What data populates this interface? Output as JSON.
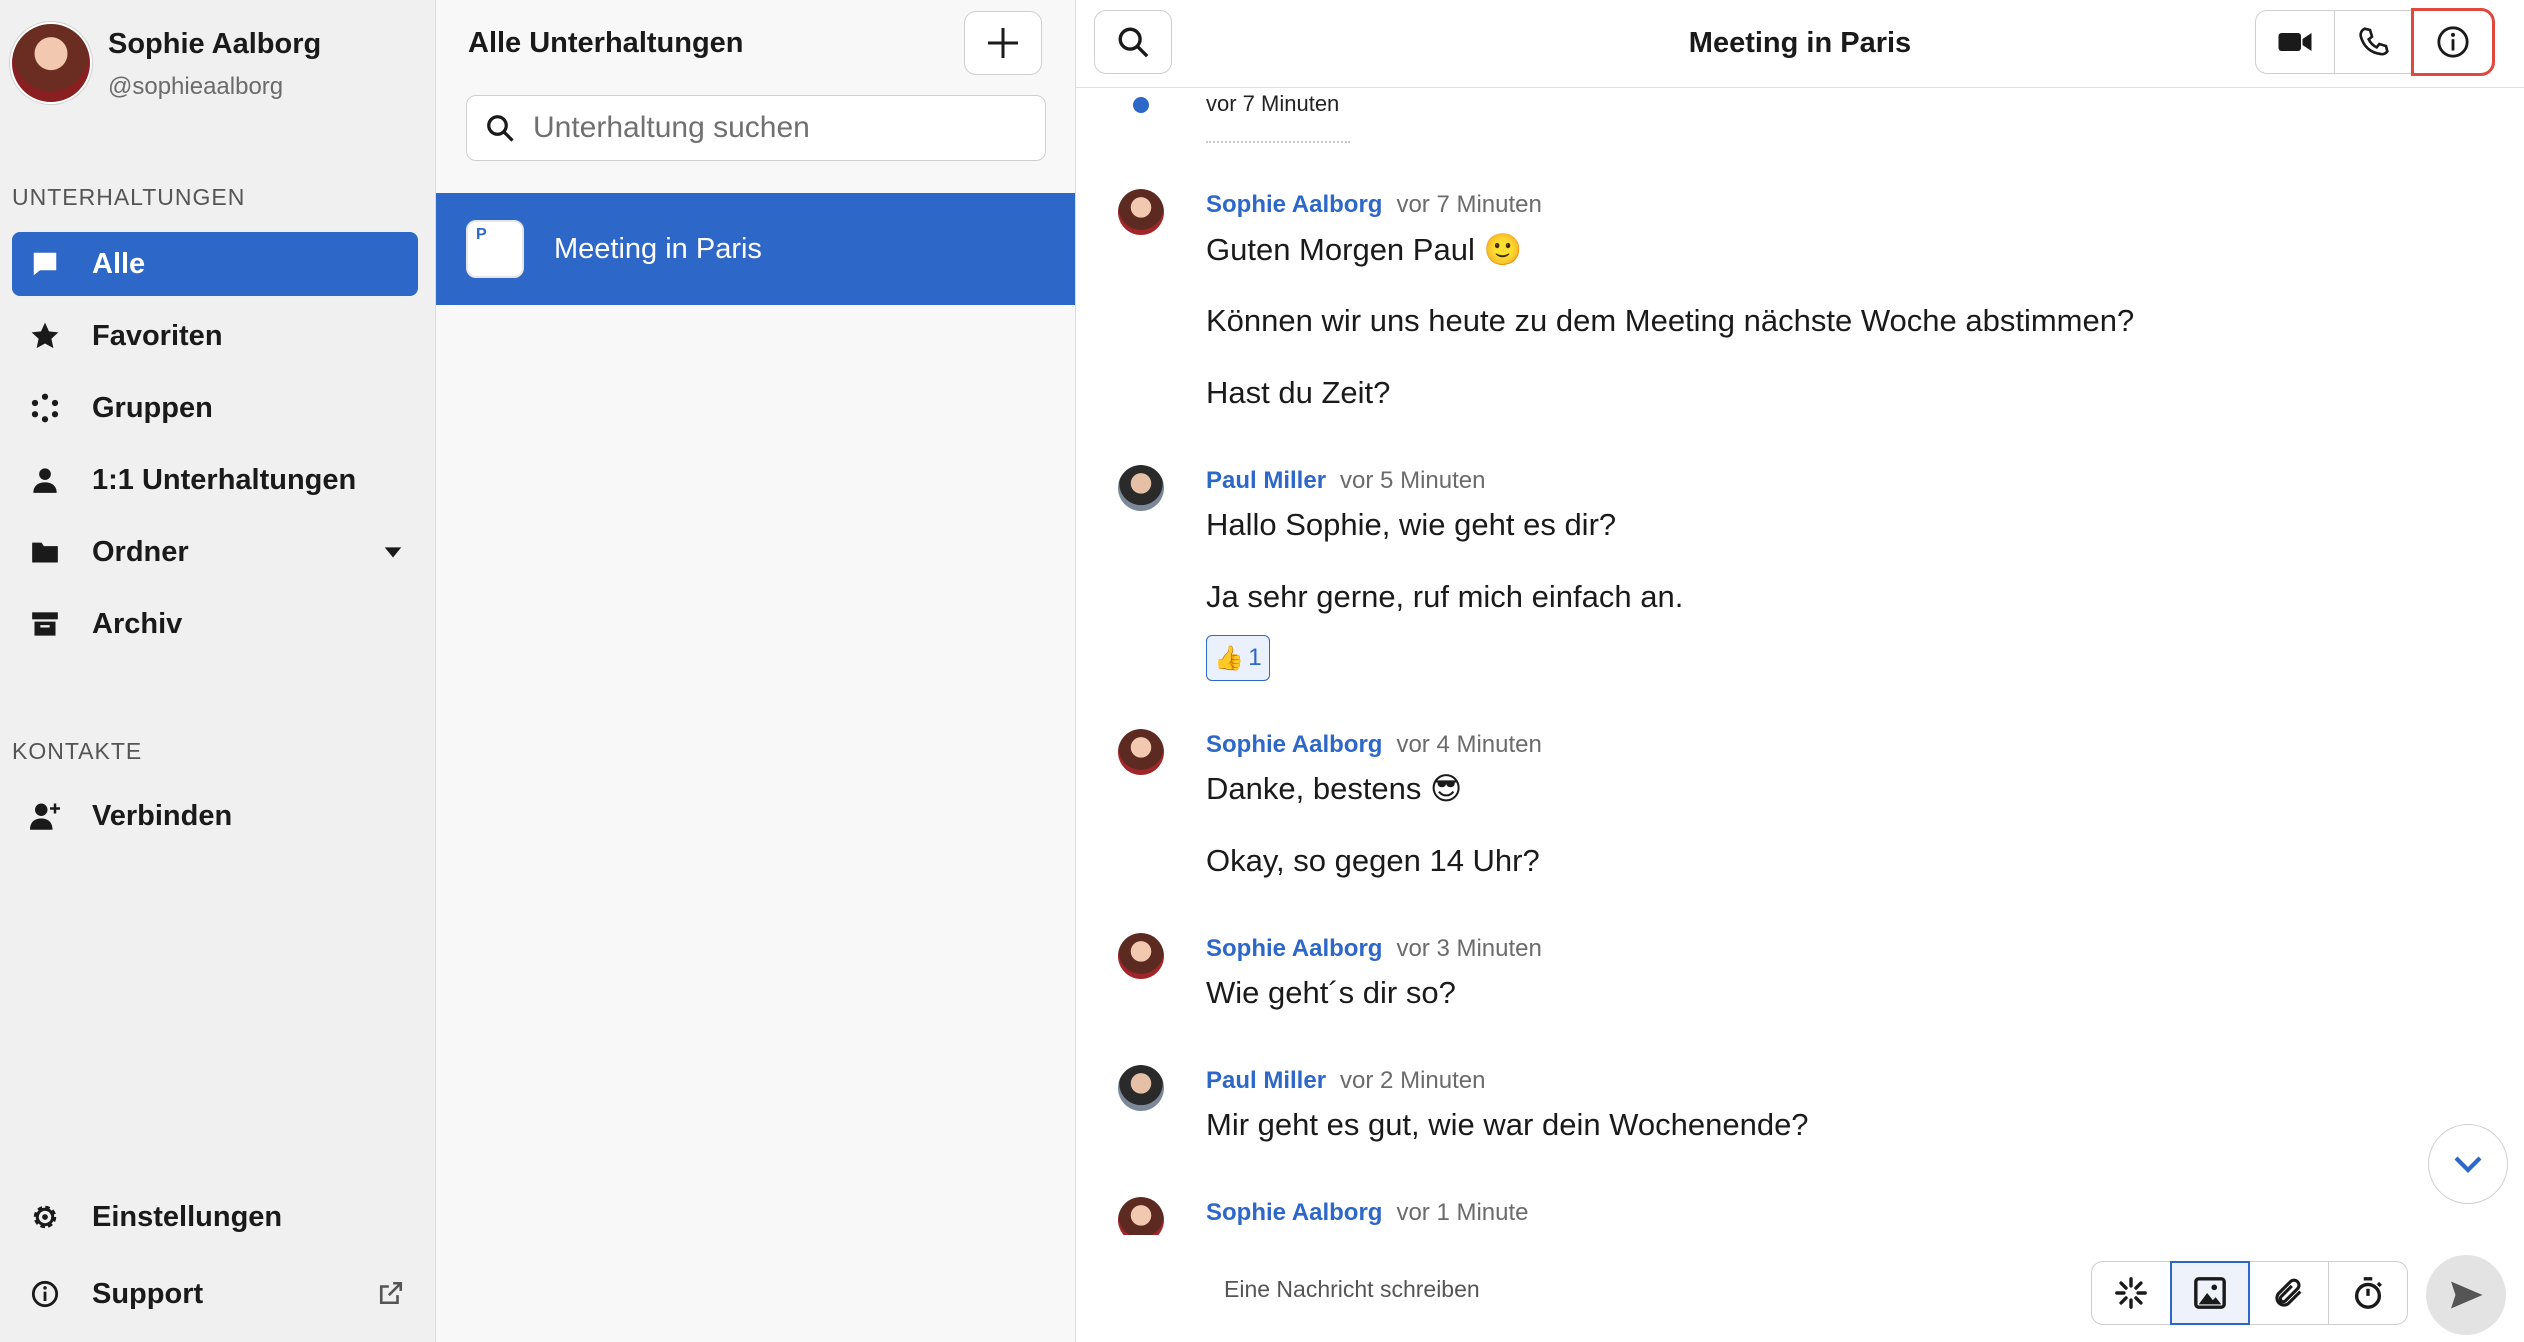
{
  "profile": {
    "name": "Sophie Aalborg",
    "handle": "@sophieaalborg"
  },
  "sidebar": {
    "section_conversations": "UNTERHALTUNGEN",
    "items": [
      {
        "label": "Alle",
        "icon": "chat-bubble-icon",
        "active": true
      },
      {
        "label": "Favoriten",
        "icon": "star-icon"
      },
      {
        "label": "Gruppen",
        "icon": "groups-icon"
      },
      {
        "label": "1:1 Unterhaltungen",
        "icon": "person-icon"
      },
      {
        "label": "Ordner",
        "icon": "folder-icon"
      },
      {
        "label": "Archiv",
        "icon": "archive-icon"
      }
    ],
    "section_contacts": "KONTAKTE",
    "connect_label": "Verbinden",
    "settings_label": "Einstellungen",
    "support_label": "Support"
  },
  "convlist": {
    "title": "Alle Unterhaltungen",
    "search_placeholder": "Unterhaltung suchen",
    "items": [
      {
        "name": "Meeting in Paris",
        "initial": "P",
        "selected": true
      }
    ]
  },
  "chat": {
    "title": "Meeting in Paris",
    "unread_marker_time": "vor 7 Minuten",
    "messages": [
      {
        "author": "Sophie Aalborg",
        "time": "vor 7 Minuten",
        "lines": [
          "Guten Morgen Paul 🙂",
          "Können wir uns heute zu dem Meeting nächste Woche abstimmen?",
          "Hast du Zeit?"
        ]
      },
      {
        "author": "Paul Miller",
        "time": "vor 5 Minuten",
        "lines": [
          "Hallo Sophie, wie geht es dir?",
          "Ja sehr gerne, ruf mich einfach an."
        ],
        "reaction": {
          "emoji": "👍",
          "count": "1"
        }
      },
      {
        "author": "Sophie Aalborg",
        "time": "vor 4 Minuten",
        "lines": [
          "Danke, bestens 😎",
          "Okay, so gegen 14 Uhr?"
        ]
      },
      {
        "author": "Sophie Aalborg",
        "time": "vor 3 Minuten",
        "lines": [
          "Wie geht´s dir so?"
        ]
      },
      {
        "author": "Paul Miller",
        "time": "vor 2 Minuten",
        "lines": [
          "Mir geht es gut, wie war dein Wochenende?"
        ]
      },
      {
        "author": "Sophie Aalborg",
        "time": "vor 1 Minute",
        "lines": []
      }
    ],
    "composer_placeholder": "Eine Nachricht schreiben"
  },
  "colors": {
    "accent": "#2d67c7",
    "highlight_border": "#e0483b",
    "sidebar_bg": "#f0f0f0"
  }
}
